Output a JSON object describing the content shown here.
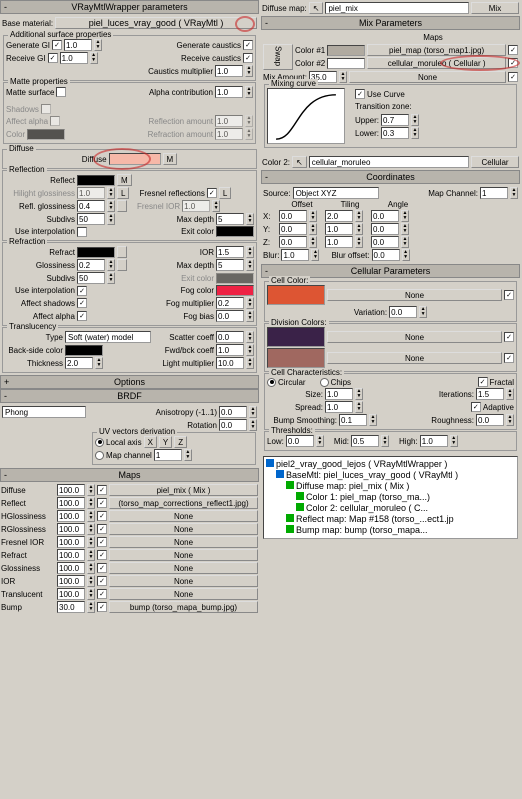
{
  "left": {
    "header": "VRayMtlWrapper parameters",
    "base_lbl": "Base material:",
    "base_val": "piel_luces_vray_good  ( VRayMtl )",
    "addl": "Additional surface properties",
    "genGI": "Generate GI",
    "genGIv": "1.0",
    "recvGI": "Receive GI",
    "recvGIv": "1.0",
    "genC": "Generate caustics",
    "recvC": "Receive caustics",
    "cmult": "Caustics multiplier",
    "cmultv": "1.0",
    "matte": "Matte properties",
    "msurf": "Matte surface",
    "acon": "Alpha contribution",
    "aconv": "1.0",
    "shadows": "Shadows",
    "aalpha": "Affect alpha",
    "color": "Color",
    "reflamt": "Reflection amount",
    "refamt": "Refraction amount",
    "one": "1.0",
    "diffuse_h": "Diffuse",
    "diffuse_l": "Diffuse",
    "M": "M",
    "reflection_h": "Reflection",
    "reflect": "Reflect",
    "hgloss": "Hilight glossiness",
    "hglossv": "1.0",
    "rgloss": "Refl. glossiness",
    "rglossv": "0.4",
    "subdivs": "Subdivs",
    "subdivsv": "50",
    "useint": "Use interpolation",
    "fresnel": "Fresnel reflections",
    "L": "L",
    "fIOR": "Fresnel IOR",
    "fIORv": "1.0",
    "maxd": "Max depth",
    "maxdv": "5",
    "exitc": "Exit color",
    "refraction_h": "Refraction",
    "refract": "Refract",
    "glossiness": "Glossiness",
    "glossv": "0.2",
    "subdv2": "50",
    "affsh": "Affect shadows",
    "affal": "Affect alpha",
    "ior": "IOR",
    "iorv": "1.5",
    "maxd2": "5",
    "fogc": "Fog color",
    "fogm": "Fog multiplier",
    "fogmv": "0.2",
    "fogb": "Fog bias",
    "fogbv": "0.0",
    "trans_h": "Translucency",
    "type": "Type",
    "typev": "Soft (water) model",
    "bsc": "Back-side color",
    "thick": "Thickness",
    "thickv": "2.0",
    "scat": "Scatter coeff",
    "scatv": "0.0",
    "fbc": "Fwd/bck coeff",
    "fbcv": "1.0",
    "lm": "Light multiplier",
    "lmv": "10.0",
    "options": "Options",
    "brdf": "BRDF",
    "phong": "Phong",
    "aniso": "Anisotropy (-1..1)",
    "anisov": "0.0",
    "rot": "Rotation",
    "rotv": "0.0",
    "uvd": "UV vectors derivation",
    "la": "Local axis",
    "X": "X",
    "Y": "Y",
    "Z": "Z",
    "mc": "Map channel",
    "mcv": "1",
    "maps_h": "Maps",
    "maps": [
      {
        "n": "Diffuse",
        "v": "100.0",
        "m": "piel_mix  ( Mix )"
      },
      {
        "n": "Reflect",
        "v": "100.0",
        "m": "(torso_map_corrections_reflect1.jpg)"
      },
      {
        "n": "HGlossiness",
        "v": "100.0",
        "m": "None"
      },
      {
        "n": "RGlossiness",
        "v": "100.0",
        "m": "None"
      },
      {
        "n": "Fresnel IOR",
        "v": "100.0",
        "m": "None"
      },
      {
        "n": "Refract",
        "v": "100.0",
        "m": "None"
      },
      {
        "n": "Glossiness",
        "v": "100.0",
        "m": "None"
      },
      {
        "n": "IOR",
        "v": "100.0",
        "m": "None"
      },
      {
        "n": "Translucent",
        "v": "100.0",
        "m": "None"
      },
      {
        "n": "Bump",
        "v": "30.0",
        "m": "bump (torso_mapa_bump.jpg)"
      }
    ]
  },
  "right": {
    "dm_lbl": "Diffuse map:",
    "dm_name": "piel_mix",
    "dm_type": "Mix",
    "mixparams": "Mix Parameters",
    "swap": "Swap",
    "mapslbl": "Maps",
    "c1": "Color #1",
    "c1m": "piel_map (torso_map1.jpg)",
    "c2": "Color #2",
    "c2m": "cellular_moruleo  ( Cellular )",
    "mixamt": "Mix Amount:",
    "mixamtv": "35.0",
    "none": "None",
    "mcurve": "Mixing curve",
    "usec": "Use Curve",
    "tz": "Transition zone:",
    "upper": "Upper:",
    "upperv": "0.7",
    "lower": "Lower:",
    "lowerv": "0.3",
    "color2_lbl": "Color 2:",
    "color2_name": "cellular_moruleo",
    "color2_type": "Cellular",
    "coords": "Coordinates",
    "source": "Source:",
    "sourcev": "Object XYZ",
    "mapch": "Map Channel:",
    "mapchv": "1",
    "offset": "Offset",
    "tiling": "Tiling",
    "angle": "Angle",
    "X": "X:",
    "Y": "Y:",
    "Z": "Z:",
    "xo": "0.0",
    "xt": "2.0",
    "xa": "0.0",
    "yo": "0.0",
    "yt": "1.0",
    "ya": "0.0",
    "zo": "0.0",
    "zt": "1.0",
    "za": "0.0",
    "blur": "Blur:",
    "blurv": "1.0",
    "bluro": "Blur offset:",
    "blurov": "0.0",
    "cellparams": "Cellular Parameters",
    "cellc": "Cell Color:",
    "var": "Variation:",
    "varv": "0.0",
    "divc": "Division Colors:",
    "cchar": "Cell Characteristics:",
    "circ": "Circular",
    "chips": "Chips",
    "fractal": "Fractal",
    "size": "Size:",
    "sizev": "1.0",
    "iter": "Iterations:",
    "iterv": "1.5",
    "adapt": "Adaptive",
    "spread": "Spread:",
    "spreadv": "1.0",
    "bsm": "Bump Smoothing:",
    "bsmv": "0.1",
    "rough": "Roughness:",
    "roughv": "0.0",
    "thresh": "Thresholds:",
    "low": "Low:",
    "lowv": "0.0",
    "mid": "Mid:",
    "midv": "0.5",
    "high": "High:",
    "highv": "1.0",
    "tree": [
      "piel2_vray_good_lejos  ( VRayMtlWrapper )",
      "BaseMtl: piel_luces_vray_good  ( VRayMtl )",
      "Diffuse map: piel_mix  ( Mix )",
      "Color 1: piel_map (torso_ma...)",
      "Color 2: cellular_moruleo  ( C...",
      "Reflect map: Map #158 (torso_...ect1.jp",
      "Bump map: bump (torso_mapa..."
    ]
  }
}
